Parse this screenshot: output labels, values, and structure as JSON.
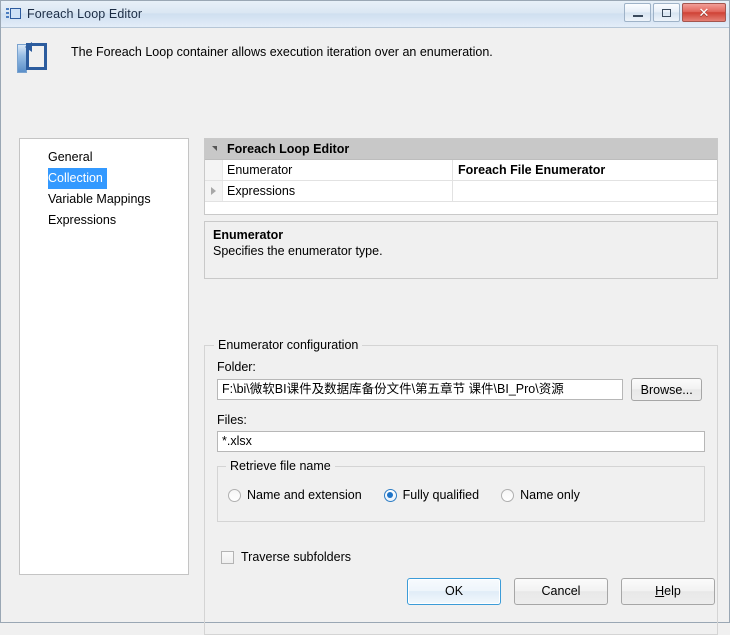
{
  "window": {
    "title": "Foreach Loop Editor",
    "icon": "foreach-loop-icon",
    "minimize_label": "",
    "maximize_label": "",
    "close_label": "✕"
  },
  "header": {
    "description": "The Foreach Loop container allows execution iteration over an enumeration."
  },
  "sidebar": {
    "items": [
      {
        "label": "General",
        "selected": false
      },
      {
        "label": "Collection",
        "selected": true
      },
      {
        "label": "Variable Mappings",
        "selected": false
      },
      {
        "label": "Expressions",
        "selected": false
      }
    ]
  },
  "property_grid": {
    "category": "Foreach Loop Editor",
    "rows": [
      {
        "name": "Enumerator",
        "value": "Foreach File Enumerator"
      },
      {
        "name": "Expressions",
        "value": ""
      }
    ]
  },
  "description_pane": {
    "title": "Enumerator",
    "text": "Specifies the enumerator type."
  },
  "enumerator_configuration": {
    "legend": "Enumerator configuration",
    "folder_label": "Folder:",
    "folder_value": "F:\\bi\\微软BI课件及数据库备份文件\\第五章节 课件\\BI_Pro\\资源",
    "browse_label": "Browse...",
    "files_label": "Files:",
    "files_value": "*.xlsx",
    "retrieve_group_legend": "Retrieve file name",
    "retrieve_options": [
      {
        "label": "Name and extension",
        "selected": false
      },
      {
        "label": "Fully qualified",
        "selected": true
      },
      {
        "label": "Name only",
        "selected": false
      }
    ],
    "traverse_label": "Traverse subfolders",
    "traverse_checked": false
  },
  "footer": {
    "ok_label": "OK",
    "cancel_label": "Cancel",
    "help_label_prefix": "H",
    "help_label_rest": "elp"
  },
  "colors": {
    "selection_blue": "#3399ff",
    "category_gray": "#c8c8c8",
    "default_button_border": "#3c9cd8"
  }
}
